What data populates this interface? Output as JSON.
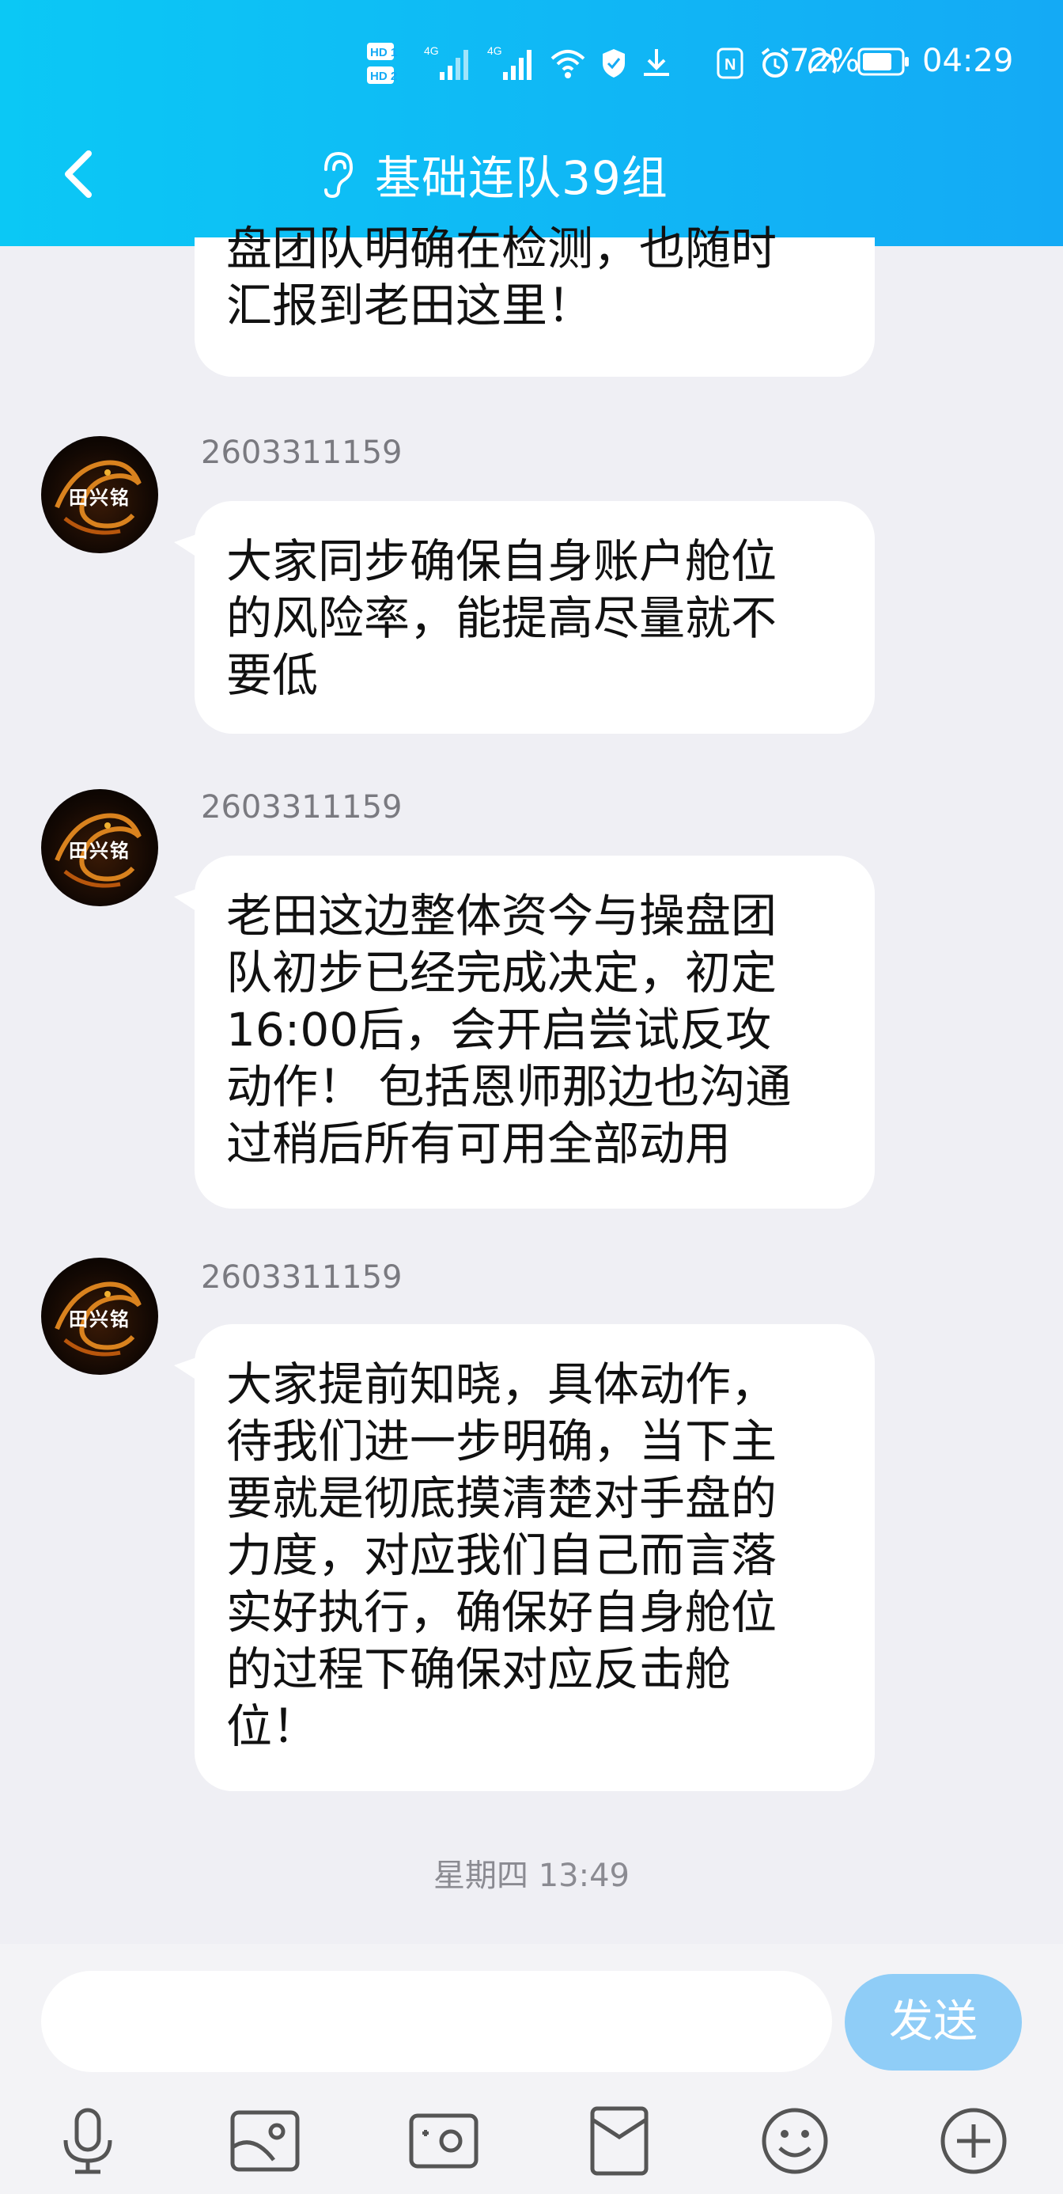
{
  "status_bar": {
    "battery_pct": "72%",
    "time": "04:29",
    "sim1": "HD 1",
    "sim2": "HD 2",
    "net1": "4G",
    "net2": "4G"
  },
  "header": {
    "title": "基础连队39组"
  },
  "messages": [
    {
      "partial": true,
      "text_lines": [
        "盘团队明确在检测，也随时",
        "汇报到老田这里！"
      ]
    },
    {
      "sender": "2603311159",
      "avatar_text": "田兴铭",
      "text_lines": [
        "大家同步确保自身账户舱位",
        "的风险率，能提高尽量就不",
        "要低"
      ]
    },
    {
      "sender": "2603311159",
      "avatar_text": "田兴铭",
      "text_lines": [
        "老田这边整体资今与操盘团",
        "队初步已经完成决定，初定",
        "16:00后，会开启尝试反攻",
        "动作！ 包括恩师那边也沟通",
        "过稍后所有可用全部动用"
      ]
    },
    {
      "sender": "2603311159",
      "avatar_text": "田兴铭",
      "text_lines": [
        "大家提前知晓，具体动作，",
        "待我们进一步明确，当下主",
        "要就是彻底摸清楚对手盘的",
        "力度，对应我们自己而言落",
        "实好执行，确保好自身舱位",
        "的过程下确保对应反击舱",
        "位！"
      ]
    }
  ],
  "timestamp": "星期四 13:49",
  "composer": {
    "input_value": "",
    "send_label": "发送"
  },
  "toolbar": {
    "icons": [
      "microphone-icon",
      "image-icon",
      "camera-icon",
      "red-packet-icon",
      "emoji-icon",
      "plus-icon"
    ]
  },
  "colors": {
    "header_start": "#0bc8f5",
    "header_end": "#14aaf5",
    "background": "#efeff4",
    "send_button": "#8fcdf7"
  }
}
